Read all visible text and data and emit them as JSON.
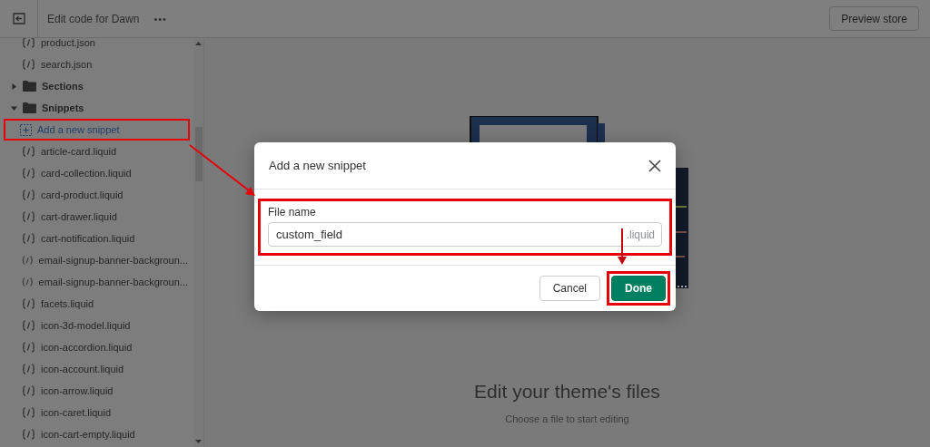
{
  "topbar": {
    "title": "Edit code for Dawn",
    "more_label": "•••",
    "preview_button": "Preview store"
  },
  "file_tree": [
    {
      "kind": "file",
      "label": "product.json"
    },
    {
      "kind": "file",
      "label": "search.json"
    },
    {
      "kind": "folder",
      "label": "Sections",
      "expanded": false
    },
    {
      "kind": "folder",
      "label": "Snippets",
      "expanded": true,
      "children": [
        {
          "kind": "add",
          "label": "Add a new snippet",
          "highlighted": true
        },
        {
          "kind": "file",
          "label": "article-card.liquid"
        },
        {
          "kind": "file",
          "label": "card-collection.liquid"
        },
        {
          "kind": "file",
          "label": "card-product.liquid"
        },
        {
          "kind": "file",
          "label": "cart-drawer.liquid"
        },
        {
          "kind": "file",
          "label": "cart-notification.liquid"
        },
        {
          "kind": "file",
          "label": "email-signup-banner-backgroun..."
        },
        {
          "kind": "file",
          "label": "email-signup-banner-backgroun..."
        },
        {
          "kind": "file",
          "label": "facets.liquid"
        },
        {
          "kind": "file",
          "label": "icon-3d-model.liquid"
        },
        {
          "kind": "file",
          "label": "icon-accordion.liquid"
        },
        {
          "kind": "file",
          "label": "icon-account.liquid"
        },
        {
          "kind": "file",
          "label": "icon-arrow.liquid"
        },
        {
          "kind": "file",
          "label": "icon-caret.liquid"
        },
        {
          "kind": "file",
          "label": "icon-cart-empty.liquid"
        }
      ]
    }
  ],
  "empty_state": {
    "heading": "Edit your theme's files",
    "subtitle": "Choose a file to start editing"
  },
  "dialog": {
    "title": "Add a new snippet",
    "field_label": "File name",
    "field_value": "custom_field",
    "field_suffix": ".liquid",
    "field_highlighted": true,
    "buttons": [
      {
        "label": "Cancel",
        "kind": "secondary",
        "highlighted": false
      },
      {
        "label": "Done",
        "kind": "primary",
        "highlighted": true
      }
    ]
  }
}
